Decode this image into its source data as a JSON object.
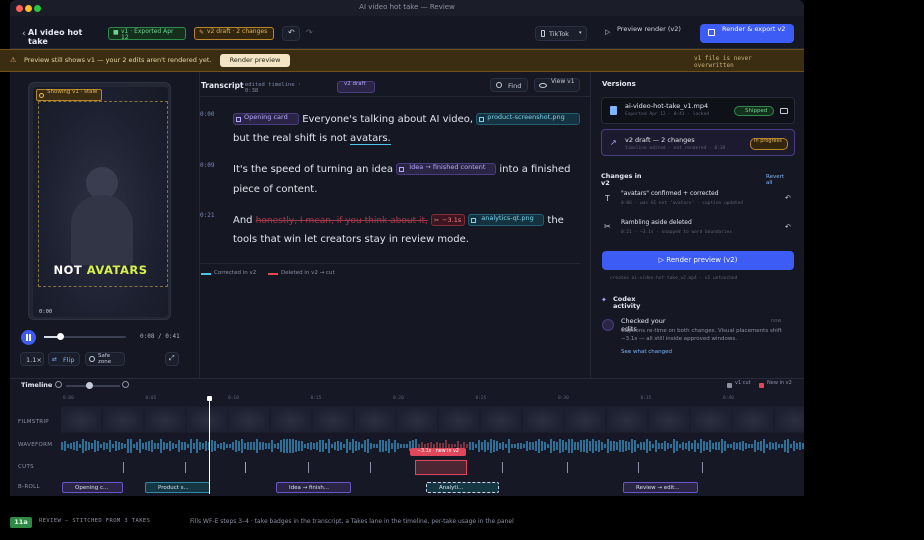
{
  "window": {
    "title": "AI video hot take — Review"
  },
  "header": {
    "project_title": "AI video hot take",
    "v1_badge": "v1 · Exported Apr 12",
    "v2_badge": "v2 draft · 2 changes",
    "platform": "TikTok",
    "preview_render": "Preview render (v2)",
    "render_export": "Render & export v2"
  },
  "banner": {
    "text": "Preview still shows v1 — your 2 edits aren't rendered yet.",
    "button": "Render preview",
    "right_note": "v1 file is never overwritten"
  },
  "preview": {
    "showing_label": "Showing v1 · stale",
    "caption_white": "NOT",
    "caption_yellow": "AVATARS",
    "time_corner": "0:00",
    "time_readout": "0:08 / 0:41",
    "speed": "1.1×",
    "flip": "Flip",
    "safe_zone": "Safe zone",
    "progress": 0.2
  },
  "transcript": {
    "title": "Transcript",
    "edited_meta": "edited timeline · 0:38",
    "draft_pill": "v2 draft",
    "find": "Find",
    "view_v1": "View v1",
    "segments": [
      {
        "time": "0:00",
        "chip": "Opening card",
        "text_a": "Everyone's talking about AI video,",
        "chip2": "product-screenshot.png",
        "text_b": "but the real shift is not",
        "highlight": "avatars."
      },
      {
        "time": "0:09",
        "text_a": "It's the speed of turning an idea",
        "chip": "Idea → finished content",
        "text_b": "into a finished",
        "text_c": "piece of content."
      },
      {
        "time": "0:21",
        "text_a": "And",
        "strike": "honestly, I mean, if you think about it,",
        "cut_chip": "−3.1s",
        "chip2": "analytics-qt.png",
        "text_b": "the",
        "text_c": "tools that win let creators stay in review mode."
      }
    ],
    "legend_corrected": "Corrected in v2",
    "legend_deleted": "Deleted in v2 → cut"
  },
  "versions": {
    "title": "Versions",
    "v1_file": "ai-video-hot-take_v1.mp4",
    "v1_meta": "Exported Apr 12 · 0:41 · locked",
    "v1_status": "Shipped",
    "v2_name": "v2 draft — 2 changes",
    "v2_meta": "timeline edited · not rendered · 0:38",
    "v2_status": "In progress"
  },
  "changes": {
    "title": "Changes in v2",
    "revert_all": "Revert all",
    "items": [
      {
        "title": "\"avatars\" confirmed + corrected",
        "meta": "0:06 · was AI not ‘avatars’ · caption updated"
      },
      {
        "title": "Rambling aside deleted",
        "meta": "0:21 · −3.1s · snapped to word boundaries"
      }
    ],
    "render_button": "Render preview (v2)",
    "render_note": "creates ai-video-hot-take_v2.mp4 · v1 untouched"
  },
  "codex": {
    "title": "Codex activity",
    "item_title": "Checked your edits",
    "item_time": "now",
    "item_body": "Captions re-time on both changes. Visual placements shift −3.1s — all still inside approved windows.",
    "link": "See what changed"
  },
  "timeline": {
    "title": "Timeline",
    "legend_v1": "v1 cut",
    "legend_v2": "New in v2",
    "ticks": [
      "0:00",
      "0:05",
      "0:10",
      "0:15",
      "0:20",
      "0:25",
      "0:30",
      "0:35",
      "0:40"
    ],
    "lanes": [
      "FILMSTRIP",
      "WAVEFORM",
      "CUTS",
      "B-ROLL"
    ],
    "cut_label": "−3.1s · new in v2",
    "broll": [
      "Opening c...",
      "Product s...",
      "Idea → finish...",
      "Analyti...",
      "Review → edit..."
    ]
  },
  "footer": {
    "badge": "11a",
    "label": "REVIEW — STITCHED FROM 3 TAKES",
    "description": "Fills WF-E steps 3–4 · take badges in the transcript, a Takes lane in the timeline, per-take usage in the panel"
  },
  "colors": {
    "accent": "#3d5bf5",
    "warning": "#3b2d12",
    "shipped": "#2f8a4c",
    "draft": "#b8862d",
    "deleted": "#e0475a",
    "corrected": "#4cc3e8"
  }
}
